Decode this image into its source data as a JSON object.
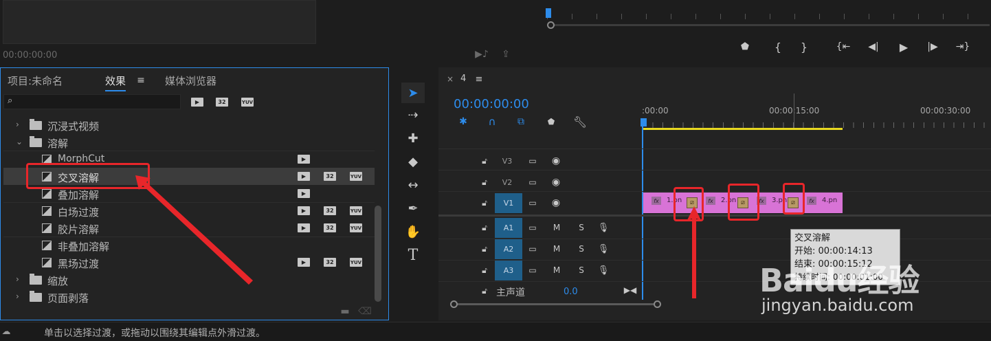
{
  "source_monitor": {
    "timecode": "00:00:00:00"
  },
  "project_panel": {
    "tabs": [
      {
        "label": "项目:未命名"
      },
      {
        "label": "效果"
      },
      {
        "label": "媒体浏览器"
      }
    ],
    "search_placeholder": "",
    "accel_badges": [
      "32",
      "YUV"
    ],
    "tree": [
      {
        "label": "沉浸式视频"
      },
      {
        "label": "溶解"
      },
      {
        "label": "MorphCut"
      },
      {
        "label": "交叉溶解"
      },
      {
        "label": "叠加溶解"
      },
      {
        "label": "白场过渡"
      },
      {
        "label": "胶片溶解"
      },
      {
        "label": "非叠加溶解"
      },
      {
        "label": "黑场过渡"
      },
      {
        "label": "缩放"
      },
      {
        "label": "页面剥落"
      }
    ]
  },
  "timeline": {
    "sequence_name": "4",
    "timecode": "00:00:00:00",
    "ruler_labels": [
      ":00:00",
      "00:00:15:00",
      "00:00:30:00"
    ],
    "tracks": {
      "v3": "V3",
      "v2": "V2",
      "v1": "V1",
      "a1": "A1",
      "a2": "A2",
      "a3": "A3",
      "m": "M",
      "s": "S"
    },
    "master": {
      "label": "主声道",
      "value": "0.0"
    },
    "clips": [
      {
        "label": "1.pn"
      },
      {
        "label": "2.pn"
      },
      {
        "label": "3.pn"
      },
      {
        "label": "4.pn"
      }
    ],
    "fx": "fx",
    "tooltip": {
      "title": "交叉溶解",
      "start": "开始: 00:00:14:13",
      "end": "结束: 00:00:15:12",
      "duration": "持续时间: 00:00:01:00"
    }
  },
  "status_bar": {
    "message": "单击以选择过渡，或拖动以围绕其编辑点外滑过渡。"
  },
  "watermark": {
    "brand": "Baidu经验",
    "url": "jingyan.baidu.com"
  },
  "colors": {
    "accent_blue": "#2d8ceb",
    "track_blue": "#1f5f8a",
    "clip_pink": "#d873d6",
    "annotation_red": "#e8262a",
    "work_area_yellow": "#e8d820"
  }
}
